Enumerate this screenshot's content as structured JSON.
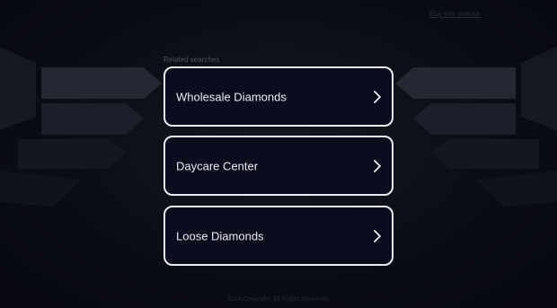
{
  "header": {
    "top_link": "Buy this domain"
  },
  "related": {
    "label": "Related searches",
    "items": [
      {
        "label": "Wholesale Diamonds",
        "icon": "chevron-right-icon"
      },
      {
        "label": "Daycare Center",
        "icon": "chevron-right-icon"
      },
      {
        "label": "Loose Diamonds",
        "icon": "chevron-right-icon"
      }
    ]
  },
  "footer": {
    "text": "2024 Copyright. All Rights Reserved."
  },
  "colors": {
    "background": "#0b0d16",
    "card_border": "#e9ebf1",
    "card_fill": "#0b0d1e",
    "text": "#e9ebf1"
  }
}
